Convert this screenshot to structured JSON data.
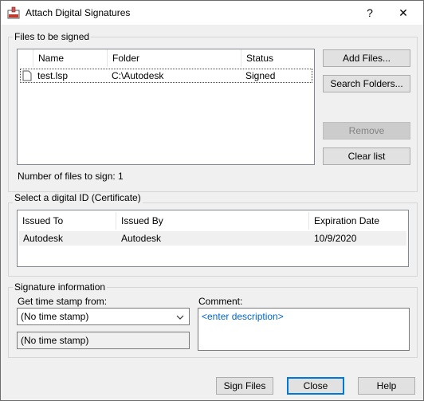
{
  "window": {
    "title": "Attach Digital Signatures",
    "help_glyph": "?",
    "close_glyph": "✕"
  },
  "files_group": {
    "label": "Files to be signed",
    "columns": [
      "Name",
      "Folder",
      "Status"
    ],
    "rows": [
      {
        "name": "test.lsp",
        "folder": "C:\\Autodesk",
        "status": "Signed"
      }
    ],
    "count_text": "Number of files to sign: 1",
    "buttons": {
      "add_files": "Add Files...",
      "search_folders": "Search Folders...",
      "remove": "Remove",
      "clear_list": "Clear list"
    }
  },
  "certificate_group": {
    "label": "Select a digital ID (Certificate)",
    "columns": [
      "Issued To",
      "Issued By",
      "Expiration Date"
    ],
    "rows": [
      {
        "issued_to": "Autodesk",
        "issued_by": "Autodesk",
        "expiration": "10/9/2020"
      }
    ]
  },
  "signature_group": {
    "label": "Signature information",
    "timestamp_label": "Get time stamp from:",
    "timestamp_selected": "(No time stamp)",
    "timestamp_readonly": "(No time stamp)",
    "comment_label": "Comment:",
    "comment_placeholder": "<enter description>"
  },
  "footer": {
    "sign_files": "Sign Files",
    "close": "Close",
    "help": "Help"
  }
}
